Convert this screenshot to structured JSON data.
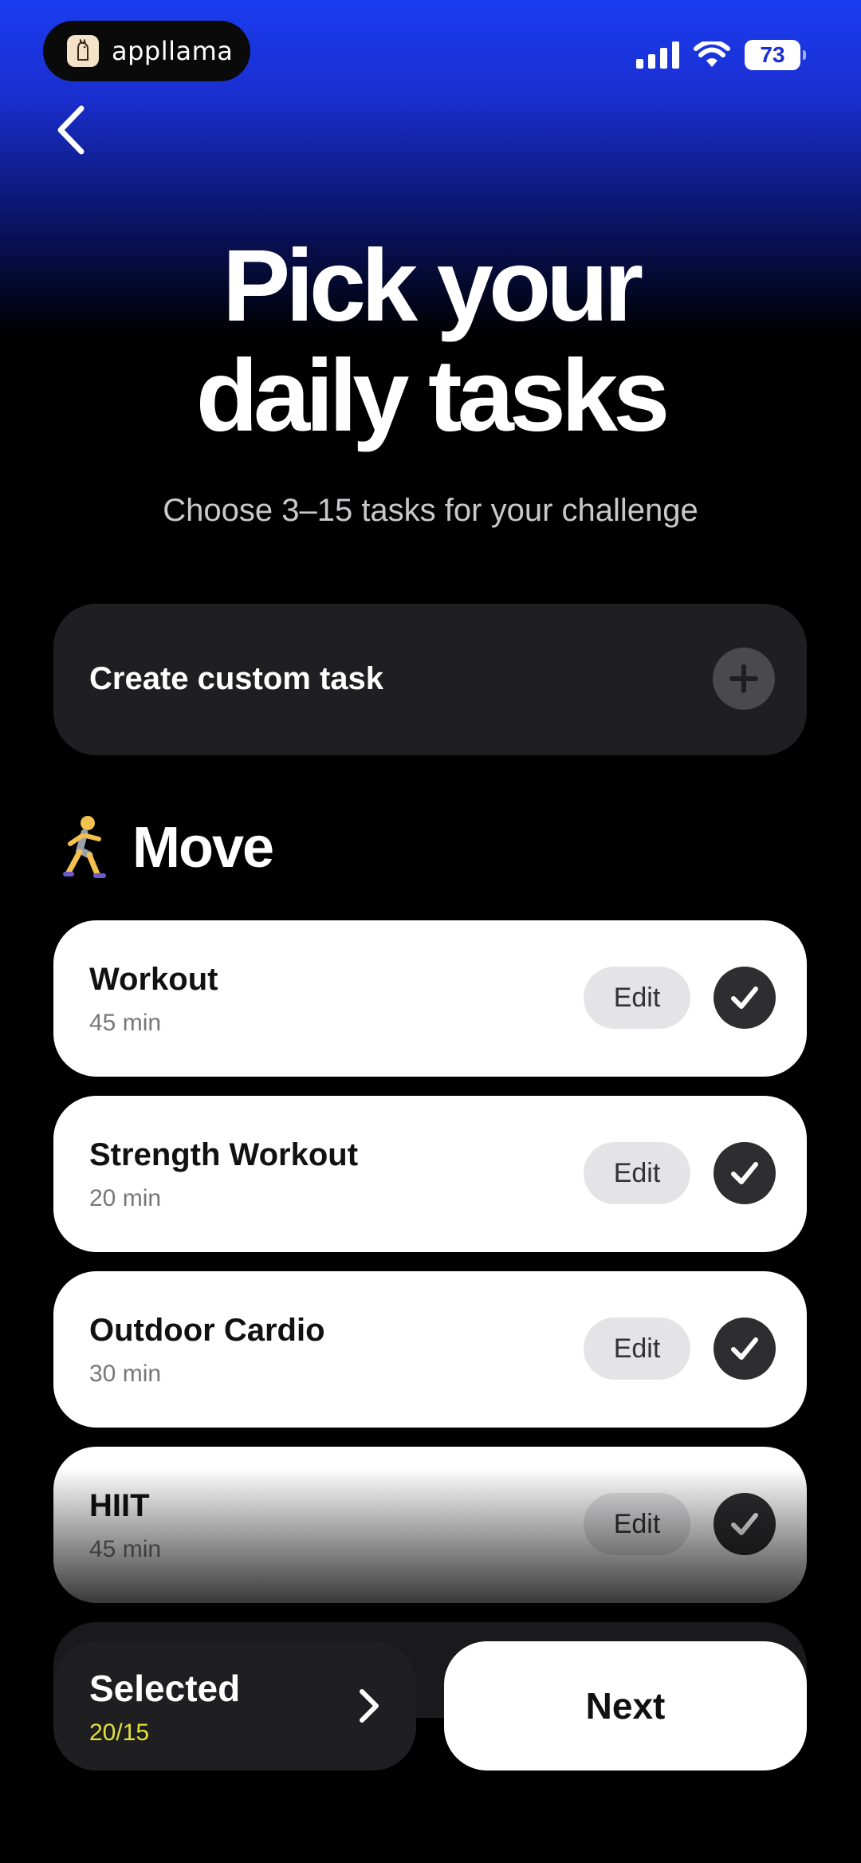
{
  "status_bar": {
    "app_name": "appllama",
    "battery": "73",
    "icons": [
      "signal-icon",
      "wifi-icon",
      "battery-icon"
    ]
  },
  "header": {
    "back_icon": "chevron-left-icon",
    "title_line1": "Pick your",
    "title_line2": "daily tasks",
    "subtitle": "Choose 3–15 tasks for your challenge"
  },
  "custom_task": {
    "label": "Create custom task",
    "icon": "plus-icon"
  },
  "section": {
    "emoji": "🏃",
    "title": "Move"
  },
  "tasks": [
    {
      "name": "Workout",
      "duration": "45 min",
      "edit_label": "Edit",
      "selected": true
    },
    {
      "name": "Strength Workout",
      "duration": "20 min",
      "edit_label": "Edit",
      "selected": true
    },
    {
      "name": "Outdoor Cardio",
      "duration": "30 min",
      "edit_label": "Edit",
      "selected": true
    },
    {
      "name": "HIIT",
      "duration": "45 min",
      "edit_label": "Edit",
      "selected": true
    }
  ],
  "footer": {
    "selected_label": "Selected",
    "selected_count": "20/15",
    "next_label": "Next"
  },
  "colors": {
    "accent_blue": "#1a3cf0",
    "count_yellow": "#e4e13a",
    "card_dark": "#1f1f21"
  }
}
